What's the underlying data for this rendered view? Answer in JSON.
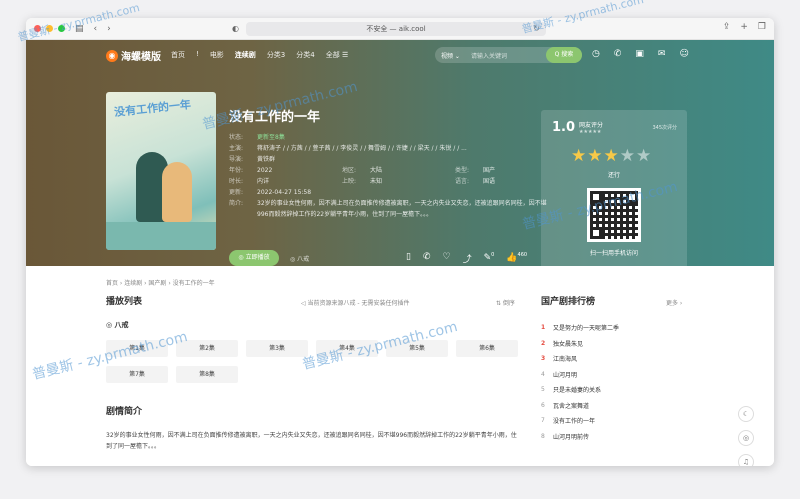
{
  "browser": {
    "url": "不安全 — aik.cool",
    "traffic_colors": [
      "#ff5f57",
      "#febc2e",
      "#28c840"
    ]
  },
  "nav": {
    "logo_text": "海螺模版",
    "menu": [
      "首页",
      "!",
      "电影",
      "连续剧",
      "分类3",
      "分类4",
      "全部 ☰"
    ],
    "active_index": 3,
    "search_category": "视频 ⌄",
    "search_placeholder": "请输入关键词",
    "search_button": "Q 搜索"
  },
  "show": {
    "title": "没有工作的一年",
    "poster_text": "没有工作的一年",
    "status_label": "状态:",
    "status_value": "更新至8集",
    "cast_label": "主演:",
    "cast_value": "蒋舒涛子 / / 方茜 / / 萱子茜 / / 李俊灵 / / 舞雪姆 / / 许婕 / / 梁天 / / 朱锐 / / ...",
    "director_label": "导演:",
    "director_value": "黄铁群",
    "year_label": "年份:",
    "year_value": "2022",
    "area_label": "地区:",
    "area_value": "大陆",
    "type_label": "类型:",
    "type_value": "国产",
    "duration_label": "时长:",
    "duration_value": "内详",
    "release_label": "上映:",
    "release_value": "未知",
    "lang_label": "语言:",
    "lang_value": "国语",
    "updated_label": "更新:",
    "updated_value": "2022-04-27 15:58",
    "intro_label": "简介:",
    "intro_value": "32岁的事业女性何雨，因不满上司在负面推传修遭被离职，一天之内失业又失恋，还被追跟同名同桂，因不堪996而毅然辞掉工作的22岁躺平青年小雨，住到了同一屋檐下。。。",
    "play_button": "◎ 立即播放",
    "source_label": "◎ 八戒",
    "stat_like": "460",
    "stat_comment": "0"
  },
  "rating": {
    "score": "1.0",
    "label": "网友评分",
    "mini_stars": "★★★★★",
    "count": "345次评分",
    "stars_on": "★★★",
    "stars_off": "★★",
    "verdict": "还行",
    "scan_text": "扫一扫用手机访问"
  },
  "content": {
    "breadcrumb": "首页 › 连续剧 › 国产剧 › 没有工作的一年",
    "playlist_title": "播放列表",
    "source_notice": "◁ 当前资源来源八戒 - 无需安装任何插件",
    "sort_label": "⇅ 倒序",
    "source_name": "◎ 八戒",
    "episodes": [
      "第1集",
      "第2集",
      "第3集",
      "第4集",
      "第5集",
      "第6集",
      "第7集",
      "第8集"
    ],
    "plot_title": "剧情简介",
    "plot_text": "32岁的事业女性何雨，因不满上司在负面推传修遭被离职，一天之内失业又失恋，还被追跟同名同桂，因不堪996而毅然辞掉工作的22岁躺平青年小雨，住到了同一屋檐下。。。",
    "rank_title": "国产剧排行榜",
    "rank_more": "更多 ›",
    "rank_items": [
      "又是努力的一天呢第二季",
      "独女晨朱见",
      "江南海风",
      "山河月明",
      "只是未婚妻的关系",
      "瓦舍之案舞道",
      "没有工作的一年",
      "山河月明前传"
    ]
  },
  "watermark": "普曼斯 - zy.prmath.com"
}
